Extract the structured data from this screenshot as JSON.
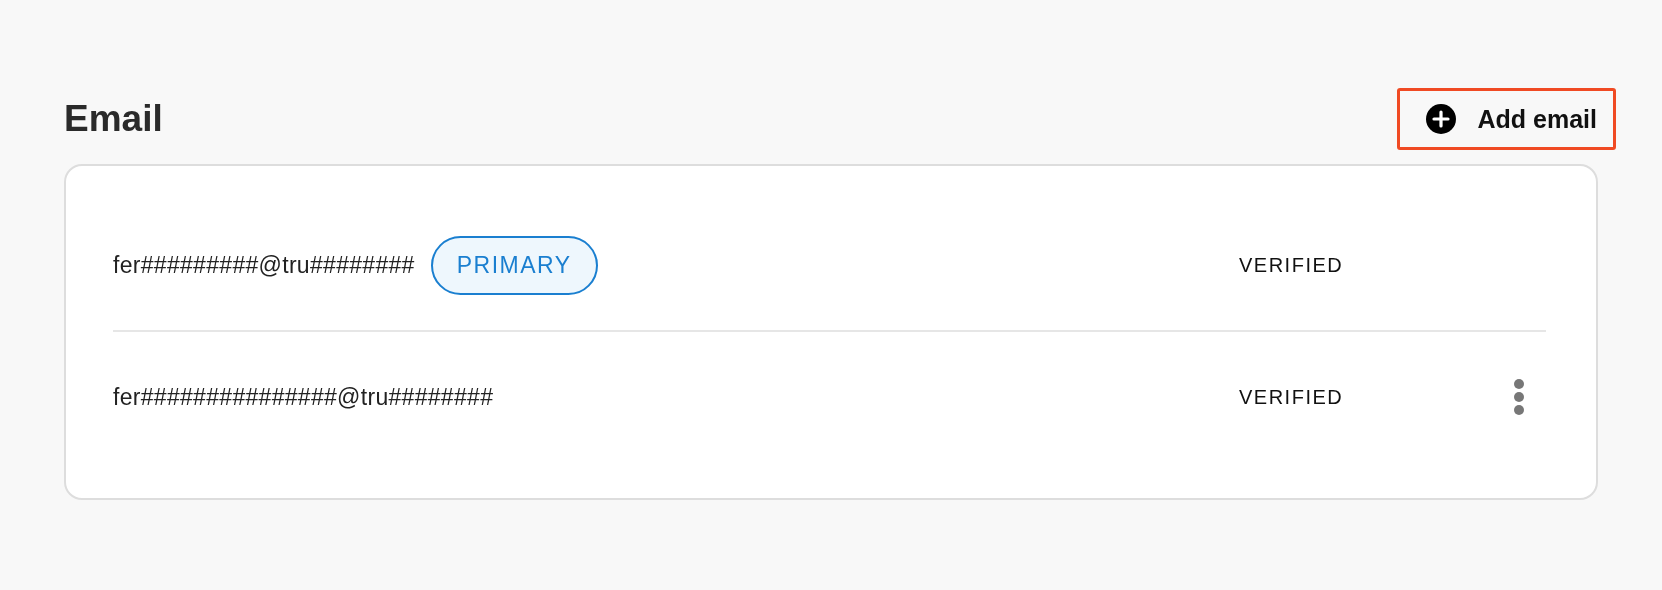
{
  "title": "Email",
  "add_button": {
    "label": "Add email",
    "focused": true
  },
  "emails": [
    {
      "address": "fer#########@tru########",
      "badge": "PRIMARY",
      "status": "VERIFIED",
      "has_menu": false
    },
    {
      "address": "fer###############@tru########",
      "status": "VERIFIED",
      "has_menu": true
    }
  ]
}
